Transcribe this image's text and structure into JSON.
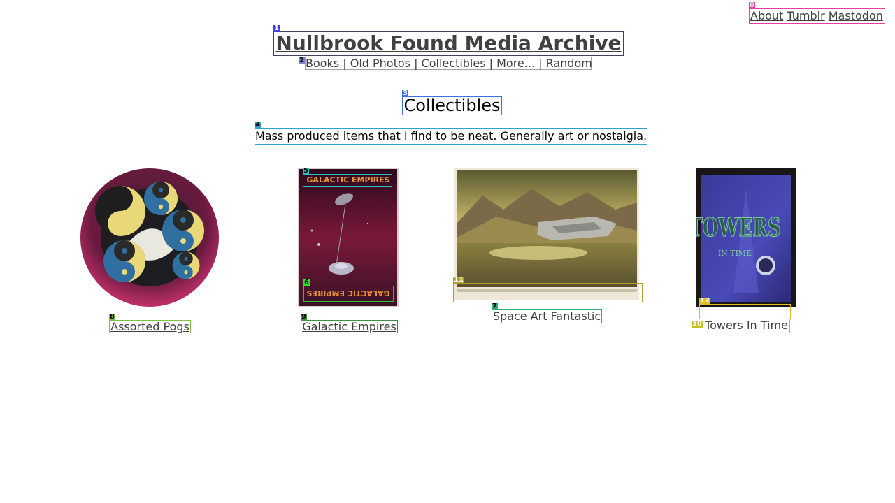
{
  "top_nav": {
    "items": [
      "About",
      "Tumblr",
      "Mastodon"
    ]
  },
  "site_title": "Nullbrook Found Media Archive",
  "category_nav": {
    "items": [
      "Books",
      "Old Photos",
      "Collectibles",
      "More...",
      "Random"
    ],
    "separator": " | "
  },
  "page_heading": "Collectibles",
  "page_description": "Mass produced items that I find to be neat. Generally art or nostalgia.",
  "gallery": [
    {
      "caption": "Assorted Pogs",
      "image": "yin-yang-pog-image"
    },
    {
      "caption": "Galactic Empires",
      "image": "galactic-empires-card-image",
      "card_text": "GALACTIC EMPIRES"
    },
    {
      "caption": "Space Art Fantastic",
      "image": "space-art-landscape-image"
    },
    {
      "caption": "Towers In Time",
      "image": "towers-in-time-card-image",
      "card_text": [
        "TOWERS",
        "IN TIME"
      ]
    }
  ],
  "overlay_labels": [
    "0",
    "1",
    "2",
    "3",
    "4",
    "5",
    "6",
    "7",
    "8",
    "9",
    "10",
    "11",
    "12"
  ],
  "colors": {
    "link": "#404040",
    "background": "#ffffff"
  }
}
